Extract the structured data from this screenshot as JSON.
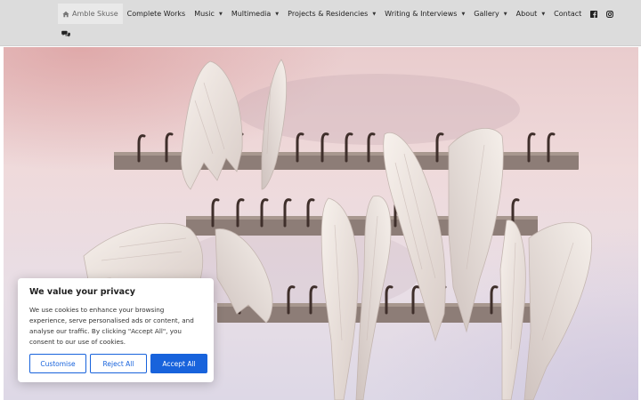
{
  "nav": {
    "items": [
      {
        "label": "Amble Skuse",
        "has_dropdown": false
      },
      {
        "label": "Complete Works",
        "has_dropdown": false
      },
      {
        "label": "Music",
        "has_dropdown": true
      },
      {
        "label": "Multimedia",
        "has_dropdown": true
      },
      {
        "label": "Projects & Residencies",
        "has_dropdown": true
      },
      {
        "label": "Writing & Interviews",
        "has_dropdown": true
      },
      {
        "label": "Gallery",
        "has_dropdown": true
      },
      {
        "label": "About",
        "has_dropdown": true
      },
      {
        "label": "Contact",
        "has_dropdown": false
      }
    ],
    "caret": "▼",
    "icons": [
      "facebook-icon",
      "instagram-icon",
      "chat-bubbles-icon"
    ]
  },
  "cookie": {
    "title": "We value your privacy",
    "text": "We use cookies to enhance your browsing experience, serve personalised ads or content, and analyse our traffic. By clicking \"Accept All\", you consent to our use of cookies.",
    "customise_label": "Customise",
    "reject_label": "Reject All",
    "accept_label": "Accept All"
  },
  "colors": {
    "nav_bg": "#dcdcdc",
    "accent": "#1863dc"
  }
}
